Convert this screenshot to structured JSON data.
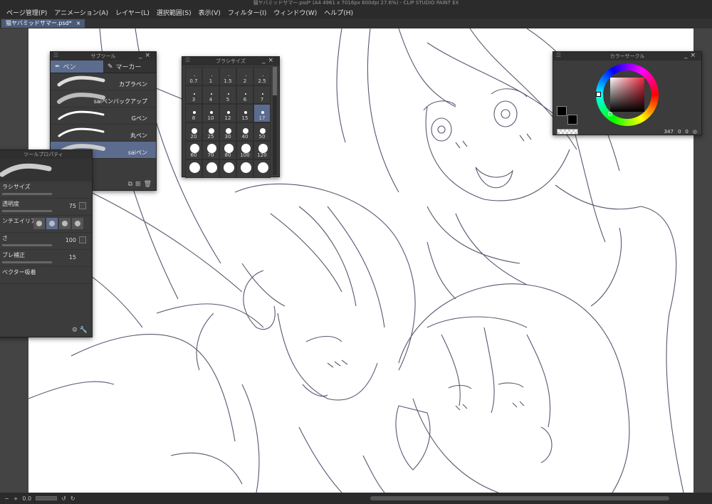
{
  "window": {
    "title": "猫ヤバミッドサマー.psd* (A4 4961 x 7016px 600dpi 27.6%) - CLIP STUDIO PAINT EX"
  },
  "menu": [
    "ページ管理(P)",
    "アニメーション(A)",
    "レイヤー(L)",
    "選択範囲(S)",
    "表示(V)",
    "フィルター(I)",
    "ウィンドウ(W)",
    "ヘルプ(H)"
  ],
  "document_tab": {
    "label": "猫ヤバミッドサマー.psd*",
    "close": "×"
  },
  "subtool": {
    "title": "サブツール",
    "tabs": [
      {
        "label": "ペン",
        "active": true
      },
      {
        "label": "マーカー",
        "active": false
      }
    ],
    "items": [
      {
        "label": "カブラペン",
        "active": false
      },
      {
        "label": "saiペンバックアップ",
        "active": false
      },
      {
        "label": "Gペン",
        "active": false
      },
      {
        "label": "丸ペン",
        "active": false
      },
      {
        "label": "saiペン",
        "active": true
      }
    ]
  },
  "toolprop": {
    "title": "ツールプロパティ",
    "rows": [
      {
        "label": "ラシサイズ",
        "value": ""
      },
      {
        "label": "透明度",
        "value": "75"
      },
      {
        "label": "ンチエイリアス",
        "value": ""
      },
      {
        "label": "さ",
        "value": "100"
      },
      {
        "label": "ブレ補正",
        "value": "15"
      },
      {
        "label": "ベクター吸着",
        "value": ""
      }
    ]
  },
  "brushsize": {
    "title": "ブラシサイズ",
    "sizes": [
      "0.7",
      "1",
      "1.5",
      "2",
      "2.5",
      "3",
      "4",
      "5",
      "6",
      "7",
      "8",
      "10",
      "12",
      "15",
      "17",
      "20",
      "25",
      "30",
      "40",
      "50",
      "60",
      "70",
      "80",
      "100",
      "120",
      "",
      "",
      "",
      "",
      ""
    ],
    "selected": "17"
  },
  "colorcircle": {
    "title": "カラーサークル",
    "readout": {
      "h": "347",
      "s": "0",
      "v": "0"
    },
    "colors": {
      "main": "#000000",
      "sub": "#000000"
    }
  },
  "status": {
    "zoom": "0.0"
  }
}
